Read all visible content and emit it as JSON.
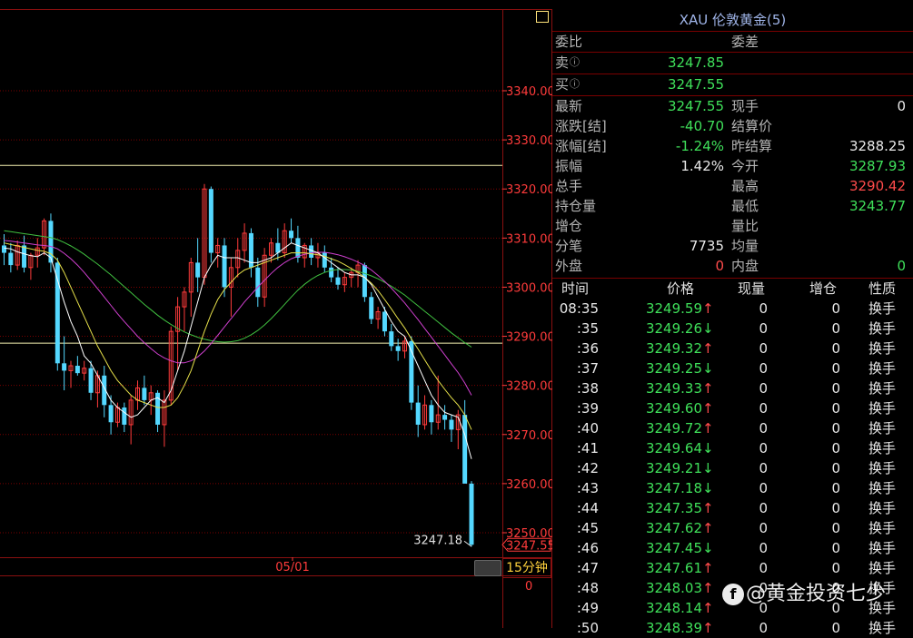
{
  "panel": {
    "title": "XAU 伦敦黄金(5)",
    "header_labels": {
      "weibi": "委比",
      "weicha": "委差"
    },
    "quotes": [
      {
        "label": "卖",
        "value": "3247.85"
      },
      {
        "label": "买",
        "value": "3247.55"
      }
    ],
    "stats_left": [
      {
        "label": "最新",
        "value": "3247.55"
      },
      {
        "label": "涨跌[结]",
        "value": "-40.70"
      },
      {
        "label": "涨幅[结]",
        "value": "-1.24%"
      },
      {
        "label": "振幅",
        "value": "1.42%"
      },
      {
        "label": "总手",
        "value": ""
      },
      {
        "label": "持仓量",
        "value": ""
      },
      {
        "label": "增仓",
        "value": ""
      },
      {
        "label": "分笔",
        "value": "7735"
      },
      {
        "label": "外盘",
        "value": "0"
      }
    ],
    "stats_right": [
      {
        "label": "现手",
        "value": "0"
      },
      {
        "label": "结算价",
        "value": ""
      },
      {
        "label": "昨结算",
        "value": "3288.25"
      },
      {
        "label": "今开",
        "value": "3287.93"
      },
      {
        "label": "最高",
        "value": "3290.42"
      },
      {
        "label": "最低",
        "value": "3243.77"
      },
      {
        "label": "量比",
        "value": ""
      },
      {
        "label": "均量",
        "value": ""
      },
      {
        "label": "内盘",
        "value": "0"
      }
    ],
    "tick_headers": [
      "时间",
      "价格",
      "现量",
      "增仓",
      "性质"
    ],
    "ticks": [
      {
        "time": "08:35",
        "price": "3249.59",
        "arrow": "↑",
        "vol": "0",
        "oi": "0",
        "type": "换手"
      },
      {
        "time": ":35",
        "price": "3249.26",
        "arrow": "↓",
        "vol": "0",
        "oi": "0",
        "type": "换手"
      },
      {
        "time": ":36",
        "price": "3249.32",
        "arrow": "↑",
        "vol": "0",
        "oi": "0",
        "type": "换手"
      },
      {
        "time": ":37",
        "price": "3249.25",
        "arrow": "↓",
        "vol": "0",
        "oi": "0",
        "type": "换手"
      },
      {
        "time": ":38",
        "price": "3249.33",
        "arrow": "↑",
        "vol": "0",
        "oi": "0",
        "type": "换手"
      },
      {
        "time": ":39",
        "price": "3249.60",
        "arrow": "↑",
        "vol": "0",
        "oi": "0",
        "type": "换手"
      },
      {
        "time": ":40",
        "price": "3249.72",
        "arrow": "↑",
        "vol": "0",
        "oi": "0",
        "type": "换手"
      },
      {
        "time": ":41",
        "price": "3249.64",
        "arrow": "↓",
        "vol": "0",
        "oi": "0",
        "type": "换手"
      },
      {
        "time": ":42",
        "price": "3249.21",
        "arrow": "↓",
        "vol": "0",
        "oi": "0",
        "type": "换手"
      },
      {
        "time": ":43",
        "price": "3247.18",
        "arrow": "↓",
        "vol": "0",
        "oi": "0",
        "type": "换手"
      },
      {
        "time": ":44",
        "price": "3247.35",
        "arrow": "↑",
        "vol": "0",
        "oi": "0",
        "type": "换手"
      },
      {
        "time": ":45",
        "price": "3247.62",
        "arrow": "↑",
        "vol": "0",
        "oi": "0",
        "type": "换手"
      },
      {
        "time": ":46",
        "price": "3247.45",
        "arrow": "↓",
        "vol": "0",
        "oi": "0",
        "type": "换手"
      },
      {
        "time": ":47",
        "price": "3247.61",
        "arrow": "↑",
        "vol": "0",
        "oi": "0",
        "type": "换手"
      },
      {
        "time": ":48",
        "price": "3248.03",
        "arrow": "↑",
        "vol": "0",
        "oi": "0",
        "type": "换手"
      },
      {
        "time": ":49",
        "price": "3248.14",
        "arrow": "↑",
        "vol": "0",
        "oi": "0",
        "type": "换手"
      },
      {
        "time": ":50",
        "price": "3248.39",
        "arrow": "↑",
        "vol": "0",
        "oi": "0",
        "type": "换手"
      }
    ]
  },
  "period_label": "15分钟",
  "volume_axis_label": "0",
  "watermark": "@黄金投资七少",
  "colors": {
    "background": "#000000",
    "up_candle": "#ff3b3b",
    "down_candle": "#54d8ff",
    "grid": "#7a0000",
    "axis_text": "#ff3b3b",
    "ma5": "#ffffff",
    "ma10": "#e6e04a",
    "ma20": "#d040d0",
    "ma60": "#40c040",
    "rise": "#ff4b4b",
    "fall": "#3fe05a"
  },
  "chart_data": {
    "type": "candlestick",
    "x_label": "05/01",
    "y_ticks": [
      3340.0,
      3330.0,
      3320.0,
      3310.0,
      3300.0,
      3290.0,
      3280.0,
      3270.0,
      3260.0,
      3250.0
    ],
    "ylim": [
      3245,
      3341
    ],
    "horizontal_lines": [
      3324.8,
      3288.6
    ],
    "low_label": "3247.18",
    "last_price_label": "3247.55",
    "candles": [
      {
        "o": 3308.5,
        "h": 3310.8,
        "l": 3304.5,
        "c": 3307.0
      },
      {
        "o": 3307.0,
        "h": 3309.0,
        "l": 3303.0,
        "c": 3304.5
      },
      {
        "o": 3304.5,
        "h": 3309.5,
        "l": 3303.5,
        "c": 3308.5
      },
      {
        "o": 3308.5,
        "h": 3310.5,
        "l": 3303.0,
        "c": 3304.0
      },
      {
        "o": 3304.0,
        "h": 3307.0,
        "l": 3301.5,
        "c": 3306.5
      },
      {
        "o": 3306.5,
        "h": 3310.0,
        "l": 3304.0,
        "c": 3308.0
      },
      {
        "o": 3308.0,
        "h": 3314.0,
        "l": 3306.5,
        "c": 3313.5
      },
      {
        "o": 3313.5,
        "h": 3315.0,
        "l": 3303.0,
        "c": 3305.0
      },
      {
        "o": 3305.0,
        "h": 3306.0,
        "l": 3283.0,
        "c": 3284.5
      },
      {
        "o": 3284.5,
        "h": 3290.0,
        "l": 3279.0,
        "c": 3283.0
      },
      {
        "o": 3283.0,
        "h": 3285.0,
        "l": 3279.5,
        "c": 3284.0
      },
      {
        "o": 3284.0,
        "h": 3286.0,
        "l": 3282.0,
        "c": 3282.5
      },
      {
        "o": 3282.5,
        "h": 3285.0,
        "l": 3281.0,
        "c": 3283.5
      },
      {
        "o": 3283.5,
        "h": 3285.0,
        "l": 3277.0,
        "c": 3278.5
      },
      {
        "o": 3278.5,
        "h": 3283.0,
        "l": 3275.5,
        "c": 3282.0
      },
      {
        "o": 3282.0,
        "h": 3284.0,
        "l": 3273.5,
        "c": 3276.0
      },
      {
        "o": 3276.0,
        "h": 3278.0,
        "l": 3270.0,
        "c": 3272.5
      },
      {
        "o": 3272.5,
        "h": 3276.5,
        "l": 3271.5,
        "c": 3275.5
      },
      {
        "o": 3275.5,
        "h": 3276.5,
        "l": 3270.5,
        "c": 3272.0
      },
      {
        "o": 3272.0,
        "h": 3278.0,
        "l": 3268.0,
        "c": 3277.0
      },
      {
        "o": 3277.0,
        "h": 3281.0,
        "l": 3275.0,
        "c": 3279.5
      },
      {
        "o": 3279.5,
        "h": 3282.0,
        "l": 3276.0,
        "c": 3277.0
      },
      {
        "o": 3277.0,
        "h": 3280.0,
        "l": 3274.0,
        "c": 3278.5
      },
      {
        "o": 3278.5,
        "h": 3279.0,
        "l": 3270.5,
        "c": 3272.0
      },
      {
        "o": 3272.0,
        "h": 3279.0,
        "l": 3267.5,
        "c": 3277.0
      },
      {
        "o": 3277.0,
        "h": 3292.0,
        "l": 3276.0,
        "c": 3291.0
      },
      {
        "o": 3291.0,
        "h": 3298.0,
        "l": 3283.0,
        "c": 3296.0
      },
      {
        "o": 3296.0,
        "h": 3300.0,
        "l": 3291.0,
        "c": 3299.0
      },
      {
        "o": 3299.0,
        "h": 3306.0,
        "l": 3294.0,
        "c": 3305.0
      },
      {
        "o": 3305.0,
        "h": 3310.0,
        "l": 3299.0,
        "c": 3302.0
      },
      {
        "o": 3302.0,
        "h": 3321.0,
        "l": 3300.5,
        "c": 3320.0
      },
      {
        "o": 3320.0,
        "h": 3320.5,
        "l": 3305.0,
        "c": 3307.0
      },
      {
        "o": 3307.0,
        "h": 3310.0,
        "l": 3304.0,
        "c": 3308.5
      },
      {
        "o": 3308.5,
        "h": 3310.0,
        "l": 3298.0,
        "c": 3300.0
      },
      {
        "o": 3300.0,
        "h": 3306.0,
        "l": 3294.0,
        "c": 3304.0
      },
      {
        "o": 3304.0,
        "h": 3310.0,
        "l": 3302.0,
        "c": 3307.5
      },
      {
        "o": 3307.5,
        "h": 3313.0,
        "l": 3305.0,
        "c": 3311.0
      },
      {
        "o": 3311.0,
        "h": 3312.0,
        "l": 3302.0,
        "c": 3304.0
      },
      {
        "o": 3304.0,
        "h": 3306.0,
        "l": 3296.0,
        "c": 3298.0
      },
      {
        "o": 3298.0,
        "h": 3308.0,
        "l": 3296.0,
        "c": 3306.5
      },
      {
        "o": 3306.5,
        "h": 3310.0,
        "l": 3305.0,
        "c": 3309.0
      },
      {
        "o": 3309.0,
        "h": 3312.0,
        "l": 3305.5,
        "c": 3307.0
      },
      {
        "o": 3307.0,
        "h": 3313.0,
        "l": 3306.0,
        "c": 3311.5
      },
      {
        "o": 3311.5,
        "h": 3314.0,
        "l": 3309.0,
        "c": 3310.0
      },
      {
        "o": 3310.0,
        "h": 3312.5,
        "l": 3305.0,
        "c": 3306.0
      },
      {
        "o": 3306.0,
        "h": 3309.0,
        "l": 3304.0,
        "c": 3308.5
      },
      {
        "o": 3308.5,
        "h": 3310.0,
        "l": 3304.5,
        "c": 3306.0
      },
      {
        "o": 3306.0,
        "h": 3309.0,
        "l": 3304.0,
        "c": 3307.0
      },
      {
        "o": 3307.0,
        "h": 3308.5,
        "l": 3303.0,
        "c": 3304.0
      },
      {
        "o": 3304.0,
        "h": 3306.0,
        "l": 3301.0,
        "c": 3302.0
      },
      {
        "o": 3302.0,
        "h": 3304.0,
        "l": 3299.5,
        "c": 3300.5
      },
      {
        "o": 3300.5,
        "h": 3303.0,
        "l": 3299.0,
        "c": 3302.0
      },
      {
        "o": 3302.0,
        "h": 3304.0,
        "l": 3300.0,
        "c": 3303.0
      },
      {
        "o": 3303.0,
        "h": 3305.5,
        "l": 3300.0,
        "c": 3304.5
      },
      {
        "o": 3304.5,
        "h": 3305.0,
        "l": 3297.0,
        "c": 3298.0
      },
      {
        "o": 3298.0,
        "h": 3299.0,
        "l": 3292.5,
        "c": 3293.5
      },
      {
        "o": 3293.5,
        "h": 3296.0,
        "l": 3291.5,
        "c": 3295.0
      },
      {
        "o": 3295.0,
        "h": 3296.0,
        "l": 3290.0,
        "c": 3291.0
      },
      {
        "o": 3291.0,
        "h": 3292.5,
        "l": 3287.0,
        "c": 3288.0
      },
      {
        "o": 3288.0,
        "h": 3289.5,
        "l": 3285.0,
        "c": 3287.0
      },
      {
        "o": 3287.0,
        "h": 3290.0,
        "l": 3285.5,
        "c": 3289.0
      },
      {
        "o": 3289.0,
        "h": 3290.0,
        "l": 3275.0,
        "c": 3276.5
      },
      {
        "o": 3276.5,
        "h": 3280.0,
        "l": 3269.5,
        "c": 3272.0
      },
      {
        "o": 3272.0,
        "h": 3278.0,
        "l": 3271.0,
        "c": 3276.0
      },
      {
        "o": 3276.0,
        "h": 3277.0,
        "l": 3270.0,
        "c": 3272.5
      },
      {
        "o": 3272.5,
        "h": 3282.0,
        "l": 3271.0,
        "c": 3274.0
      },
      {
        "o": 3274.0,
        "h": 3276.0,
        "l": 3271.0,
        "c": 3273.0
      },
      {
        "o": 3273.0,
        "h": 3274.0,
        "l": 3268.5,
        "c": 3271.0
      },
      {
        "o": 3271.0,
        "h": 3275.0,
        "l": 3267.0,
        "c": 3274.0
      },
      {
        "o": 3274.0,
        "h": 3277.0,
        "l": 3266.0,
        "c": 3260.0
      },
      {
        "o": 3260.0,
        "h": 3260.5,
        "l": 3247.18,
        "c": 3247.55
      }
    ],
    "ma5": [
      3308.0,
      3307.8,
      3307.2,
      3306.8,
      3306.4,
      3306.2,
      3307.0,
      3306.0,
      3301.5,
      3297.0,
      3293.0,
      3290.0,
      3286.0,
      3284.5,
      3282.0,
      3279.5,
      3277.0,
      3275.5,
      3274.5,
      3273.5,
      3274.0,
      3275.5,
      3277.0,
      3277.5,
      3276.5,
      3279.0,
      3283.0,
      3287.0,
      3292.0,
      3297.0,
      3302.0,
      3304.5,
      3306.5,
      3306.0,
      3306.0,
      3306.0,
      3305.5,
      3305.0,
      3305.0,
      3305.5,
      3306.0,
      3307.0,
      3308.0,
      3309.0,
      3308.5,
      3308.0,
      3307.5,
      3307.0,
      3306.0,
      3305.0,
      3304.0,
      3303.0,
      3302.5,
      3302.5,
      3302.0,
      3300.5,
      3298.0,
      3295.5,
      3293.0,
      3291.0,
      3290.0,
      3287.0,
      3284.0,
      3281.0,
      3278.0,
      3276.0,
      3274.5,
      3274.0,
      3273.5,
      3270.0,
      3265.0
    ],
    "ma10": [
      3309.0,
      3308.7,
      3308.4,
      3308.1,
      3307.8,
      3307.5,
      3307.3,
      3306.8,
      3305.5,
      3303.0,
      3300.0,
      3297.0,
      3294.0,
      3291.0,
      3288.0,
      3285.5,
      3283.0,
      3281.0,
      3279.5,
      3278.0,
      3277.0,
      3276.5,
      3276.0,
      3275.5,
      3275.5,
      3276.0,
      3277.5,
      3280.0,
      3283.0,
      3287.0,
      3291.0,
      3294.5,
      3297.5,
      3299.5,
      3301.0,
      3302.5,
      3303.5,
      3304.0,
      3304.5,
      3305.0,
      3305.5,
      3306.0,
      3306.5,
      3307.0,
      3307.0,
      3307.0,
      3306.8,
      3306.6,
      3306.3,
      3305.8,
      3305.3,
      3304.6,
      3303.8,
      3303.0,
      3302.0,
      3300.8,
      3299.3,
      3297.5,
      3295.6,
      3293.6,
      3291.7,
      3289.5,
      3287.4,
      3285.2,
      3283.0,
      3281.0,
      3279.2,
      3277.5,
      3276.0,
      3274.0,
      3271.0
    ],
    "ma20": [
      3309.5,
      3309.4,
      3309.2,
      3309.0,
      3308.8,
      3308.6,
      3308.5,
      3308.3,
      3307.8,
      3306.9,
      3305.8,
      3304.5,
      3303.0,
      3301.4,
      3299.7,
      3298.0,
      3296.3,
      3294.6,
      3293.0,
      3291.5,
      3290.0,
      3288.7,
      3287.5,
      3286.4,
      3285.6,
      3285.0,
      3284.6,
      3284.6,
      3285.0,
      3285.8,
      3287.0,
      3288.5,
      3290.2,
      3291.9,
      3293.6,
      3295.3,
      3297.0,
      3298.5,
      3300.0,
      3301.4,
      3302.8,
      3304.0,
      3305.0,
      3305.8,
      3306.3,
      3306.7,
      3307.0,
      3307.1,
      3307.1,
      3306.9,
      3306.6,
      3306.2,
      3305.7,
      3305.1,
      3304.4,
      3303.5,
      3302.4,
      3301.2,
      3299.8,
      3298.3,
      3296.8,
      3295.1,
      3293.4,
      3291.6,
      3289.8,
      3288.0,
      3286.2,
      3284.4,
      3282.6,
      3280.5,
      3278.0
    ],
    "ma60": [
      3311.5,
      3311.3,
      3311.1,
      3310.9,
      3310.7,
      3310.5,
      3310.3,
      3310.1,
      3309.7,
      3309.1,
      3308.4,
      3307.6,
      3306.7,
      3305.7,
      3304.7,
      3303.6,
      3302.5,
      3301.3,
      3300.1,
      3298.9,
      3297.7,
      3296.5,
      3295.4,
      3294.3,
      3293.3,
      3292.4,
      3291.6,
      3290.9,
      3290.3,
      3289.8,
      3289.4,
      3289.1,
      3288.9,
      3288.8,
      3288.9,
      3289.1,
      3289.6,
      3290.3,
      3291.2,
      3292.3,
      3293.6,
      3295.0,
      3296.5,
      3298.0,
      3299.4,
      3300.6,
      3301.6,
      3302.4,
      3303.0,
      3303.4,
      3303.6,
      3303.6,
      3303.5,
      3303.2,
      3302.8,
      3302.3,
      3301.7,
      3301.0,
      3300.2,
      3299.3,
      3298.4,
      3297.3,
      3296.2,
      3295.1,
      3294.0,
      3292.9,
      3291.8,
      3290.7,
      3289.7,
      3288.7,
      3287.8
    ]
  }
}
